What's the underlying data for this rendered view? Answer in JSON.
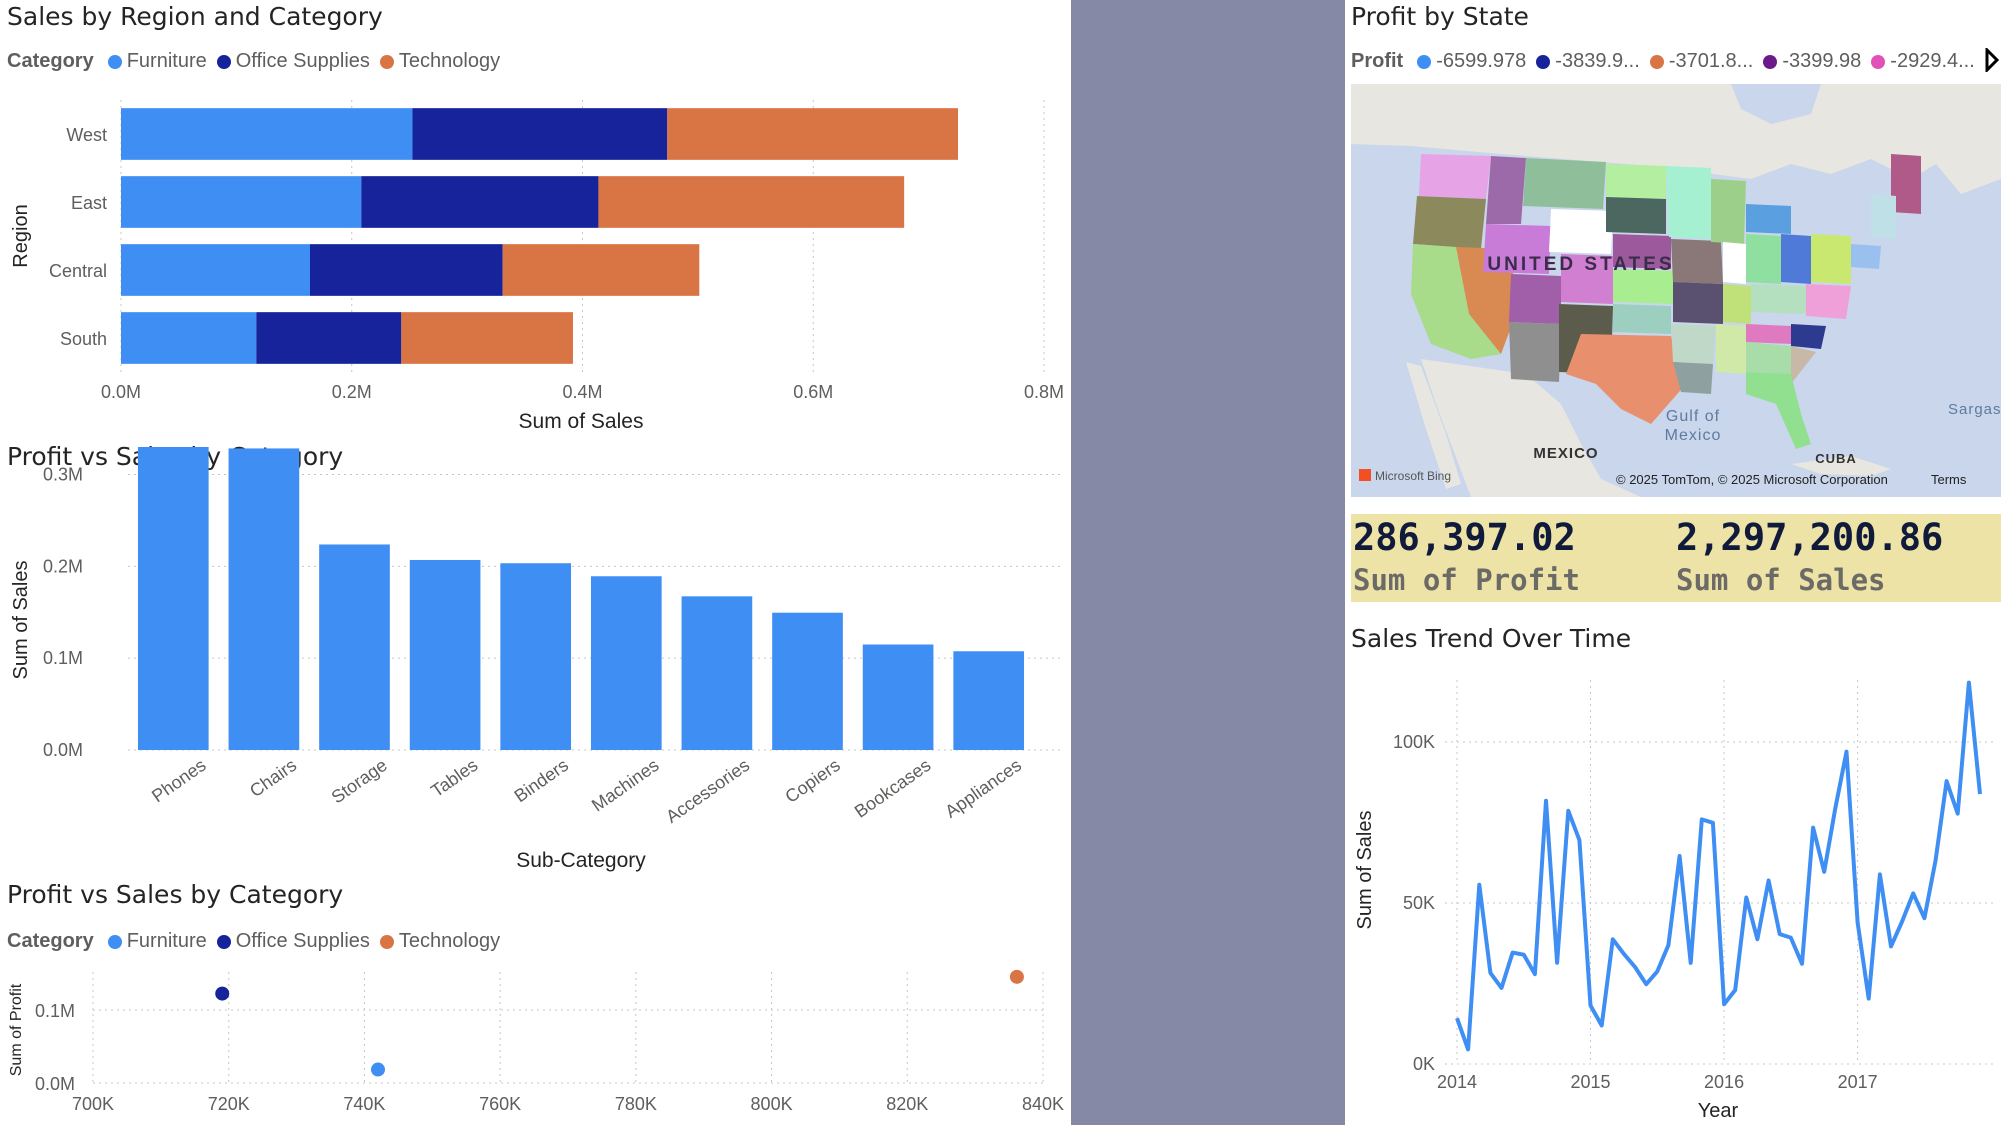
{
  "colors": {
    "furniture": "#3f8ef3",
    "office_supplies": "#17239a",
    "technology": "#d97445",
    "bar_single": "#3f8ef3",
    "line": "#3f8ef3",
    "kpi_bg": "#ede3a7",
    "divider": "#8589a6"
  },
  "region_chart": {
    "title": "Sales by Region and Category",
    "legend_title": "Category",
    "legend": [
      "Furniture",
      "Office Supplies",
      "Technology"
    ]
  },
  "subcat_chart": {
    "title": "Profit vs Sales by Category"
  },
  "scatter_chart": {
    "title": "Profit vs Sales by Category",
    "legend_title": "Category",
    "legend": [
      "Furniture",
      "Office Supplies",
      "Technology"
    ]
  },
  "map": {
    "title": "Profit by State",
    "legend_title": "Profit",
    "legend": [
      {
        "label": "-6599.978",
        "color": "#3f8ef3"
      },
      {
        "label": "-3839.9...",
        "color": "#17239a"
      },
      {
        "label": "-3701.8...",
        "color": "#d97445"
      },
      {
        "label": "-3399.98",
        "color": "#6a1a8a"
      },
      {
        "label": "-2929.4...",
        "color": "#e251b8"
      }
    ],
    "labels": {
      "country": "UNITED STATES",
      "gulf": "Gulf of Mexico",
      "mexico": "MEXICO",
      "cuba": "CUBA",
      "sargasso": "Sargass",
      "bing": "Microsoft Bing",
      "copyright": "© 2025 TomTom, © 2025 Microsoft Corporation",
      "terms": "Terms"
    }
  },
  "kpi": {
    "profit_value": "286,397.02",
    "profit_label": "Sum of Profit",
    "sales_value": "2,297,200.86",
    "sales_label": "Sum of Sales"
  },
  "trend_chart": {
    "title": "Sales Trend Over Time"
  },
  "chart_data": [
    {
      "type": "bar",
      "orientation": "horizontal",
      "stacked": true,
      "title": "Sales by Region and Category",
      "categories": [
        "West",
        "East",
        "Central",
        "South"
      ],
      "series": [
        {
          "name": "Furniture",
          "values": [
            252612,
            208291,
            163797,
            117299
          ]
        },
        {
          "name": "Office Supplies",
          "values": [
            220853,
            205516,
            167026,
            125652
          ]
        },
        {
          "name": "Technology",
          "values": [
            251992,
            264974,
            170416,
            148772
          ]
        }
      ],
      "xlabel": "Sum of Sales",
      "ylabel": "Region",
      "xlim": [
        0,
        800000
      ],
      "xticks": [
        "0.0M",
        "0.2M",
        "0.4M",
        "0.6M",
        "0.8M"
      ],
      "grid": true,
      "legend_position": "top-left"
    },
    {
      "type": "bar",
      "title": "Profit vs Sales by Category",
      "categories": [
        "Phones",
        "Chairs",
        "Storage",
        "Tables",
        "Binders",
        "Machines",
        "Accessories",
        "Copiers",
        "Bookcases",
        "Appliances"
      ],
      "values": [
        330007,
        328449,
        223844,
        206966,
        203413,
        189239,
        167380,
        149528,
        114880,
        107532
      ],
      "xlabel": "Sub-Category",
      "ylabel": "Sum of Sales",
      "ylim": [
        0,
        330007
      ],
      "yticks": [
        "0.0M",
        "0.1M",
        "0.2M",
        "0.3M"
      ],
      "grid": true
    },
    {
      "type": "scatter",
      "title": "Profit vs Sales by Category",
      "series": [
        {
          "name": "Furniture",
          "x": [
            742000
          ],
          "y": [
            18451
          ]
        },
        {
          "name": "Office Supplies",
          "x": [
            719047
          ],
          "y": [
            122491
          ]
        },
        {
          "name": "Technology",
          "x": [
            836154
          ],
          "y": [
            145455
          ]
        }
      ],
      "xlabel": "",
      "ylabel": "Sum of Profit",
      "xlim": [
        700000,
        840000
      ],
      "ylim": [
        0,
        150000
      ],
      "xticks": [
        "700K",
        "720K",
        "740K",
        "760K",
        "780K",
        "800K",
        "820K",
        "840K"
      ],
      "yticks": [
        "0.0M",
        "0.1M"
      ],
      "grid": true,
      "legend_position": "top-left"
    },
    {
      "type": "line",
      "title": "Sales Trend Over Time",
      "x": [
        "2014-01",
        "2014-02",
        "2014-03",
        "2014-04",
        "2014-05",
        "2014-06",
        "2014-07",
        "2014-08",
        "2014-09",
        "2014-10",
        "2014-11",
        "2014-12",
        "2015-01",
        "2015-02",
        "2015-03",
        "2015-04",
        "2015-05",
        "2015-06",
        "2015-07",
        "2015-08",
        "2015-09",
        "2015-10",
        "2015-11",
        "2015-12",
        "2016-01",
        "2016-02",
        "2016-03",
        "2016-04",
        "2016-05",
        "2016-06",
        "2016-07",
        "2016-08",
        "2016-09",
        "2016-10",
        "2016-11",
        "2016-12",
        "2017-01",
        "2017-02",
        "2017-03",
        "2017-04",
        "2017-05",
        "2017-06",
        "2017-07",
        "2017-08",
        "2017-09",
        "2017-10",
        "2017-11",
        "2017-12"
      ],
      "y": [
        14237,
        4520,
        55691,
        28295,
        23648,
        34595,
        33946,
        27909,
        81777,
        31453,
        78629,
        69546,
        18174,
        11951,
        38726,
        34195,
        30132,
        24797,
        28765,
        36898,
        64596,
        31405,
        75973,
        74919,
        18542,
        22979,
        51715,
        38750,
        56988,
        40344,
        39262,
        31115,
        73410,
        59688,
        79412,
        96999,
        43971,
        20301,
        58872,
        36522,
        44261,
        52982,
        45264,
        63121,
        87867,
        77777,
        118448,
        83829
      ],
      "xlabel": "Year",
      "ylabel": "Sum of Sales",
      "ylim": [
        0,
        118448
      ],
      "xticks": [
        "2014",
        "2015",
        "2016",
        "2017"
      ],
      "yticks": [
        "0K",
        "50K",
        "100K"
      ],
      "grid": true
    }
  ]
}
